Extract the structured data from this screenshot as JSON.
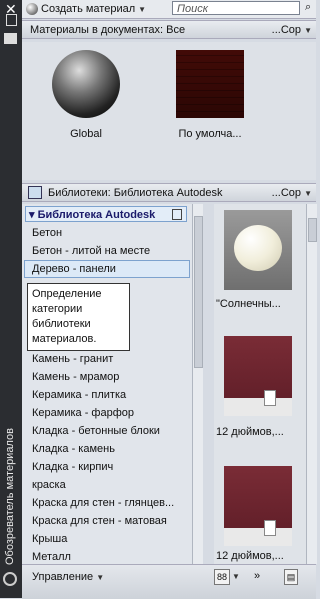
{
  "sidebar": {
    "close_glyph": "✕",
    "vertical_title": "Обозреватель материалов"
  },
  "toolbar": {
    "create_label": "Создать материал",
    "search_placeholder": "Поиск"
  },
  "documents": {
    "header": "Материалы в документах: Все",
    "sort_label": "...Сор",
    "swatches": [
      {
        "label": "Global",
        "icon": "sphere"
      },
      {
        "label": "По умолча...",
        "icon": "brick"
      }
    ]
  },
  "libraries": {
    "header": "Библиотеки: Библиотека Autodesk",
    "sort_label": "...Сор",
    "root": "Библиотека Autodesk",
    "items": [
      "Бетон",
      "Бетон - литой на месте",
      "Дерево - панели",
      "Камень - гранит",
      "Камень - мрамор",
      "Керамика - плитка",
      "Керамика - фарфор",
      "Кладка - бетонные блоки",
      "Кладка - камень",
      "Кладка - кирпич",
      "краска",
      "Краска для стен - глянцев...",
      "Краска для стен - матовая",
      "Крыша",
      "Металл"
    ],
    "selected_index": 2,
    "tooltip": "Определение категории библиотеки материалов.",
    "previews": [
      {
        "label": "\"Солнечны...",
        "icon": "vase"
      },
      {
        "label": "12 дюймов,...",
        "icon": "wall"
      },
      {
        "label": "12 дюймов,...",
        "icon": "wall"
      }
    ]
  },
  "footer": {
    "manage_label": "Управление",
    "view_icon": "grid-icon",
    "more_label": "»"
  }
}
